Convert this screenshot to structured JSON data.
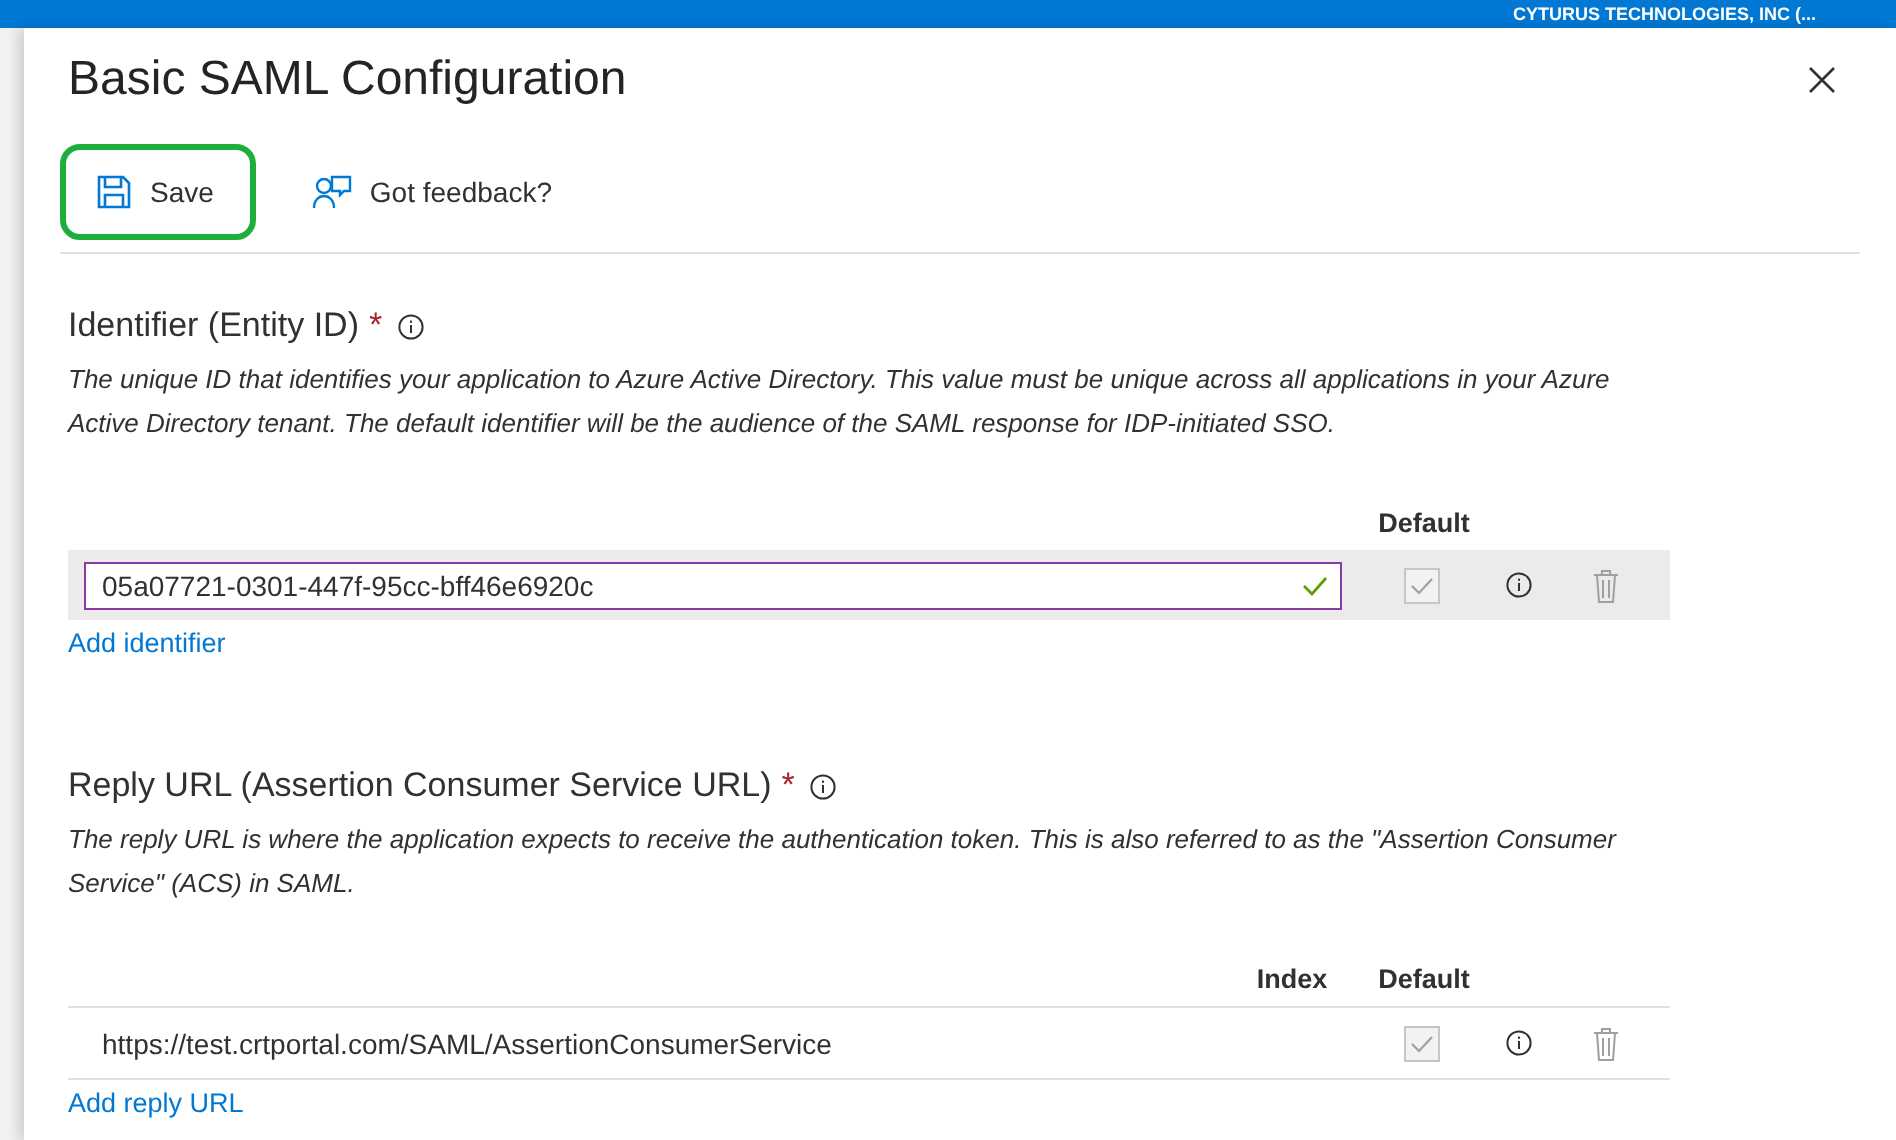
{
  "top_bar": {
    "tenant": "CYTURUS TECHNOLOGIES, INC (..."
  },
  "title": "Basic SAML Configuration",
  "toolbar": [
    {
      "kind": "save",
      "label": "Save",
      "highlighted": true
    },
    {
      "kind": "feedback",
      "label": "Got feedback?",
      "highlighted": false
    }
  ],
  "sections": [
    {
      "heading": "Identifier (Entity ID)",
      "required_mark": "*",
      "description": "The unique ID that identifies your application to Azure Active Directory. This value must be unique across all applications in your Azure Active Directory tenant. The default identifier will be the audience of the SAML response for IDP-initiated SSO.",
      "columns": [
        {
          "kind": "default",
          "label": "Default"
        }
      ],
      "rows": [
        {
          "kind": "input",
          "value": "05a07721-0301-447f-95cc-bff46e6920c",
          "valid": true,
          "highlighted": true,
          "default_checked": true,
          "default_disabled": true
        }
      ],
      "add_link": "Add identifier"
    },
    {
      "heading": "Reply URL (Assertion Consumer Service URL)",
      "required_mark": "*",
      "description": "The reply URL is where the application expects to receive the authentication token. This is also referred to as the \"Assertion Consumer Service\" (ACS) in SAML.",
      "columns": [
        {
          "kind": "index",
          "label": "Index"
        },
        {
          "kind": "default",
          "label": "Default"
        }
      ],
      "rows": [
        {
          "kind": "text",
          "value": "https://test.crtportal.com/SAML/AssertionConsumerService",
          "highlighted": false,
          "default_checked": true,
          "default_disabled": true
        }
      ],
      "add_link": "Add reply URL"
    }
  ]
}
